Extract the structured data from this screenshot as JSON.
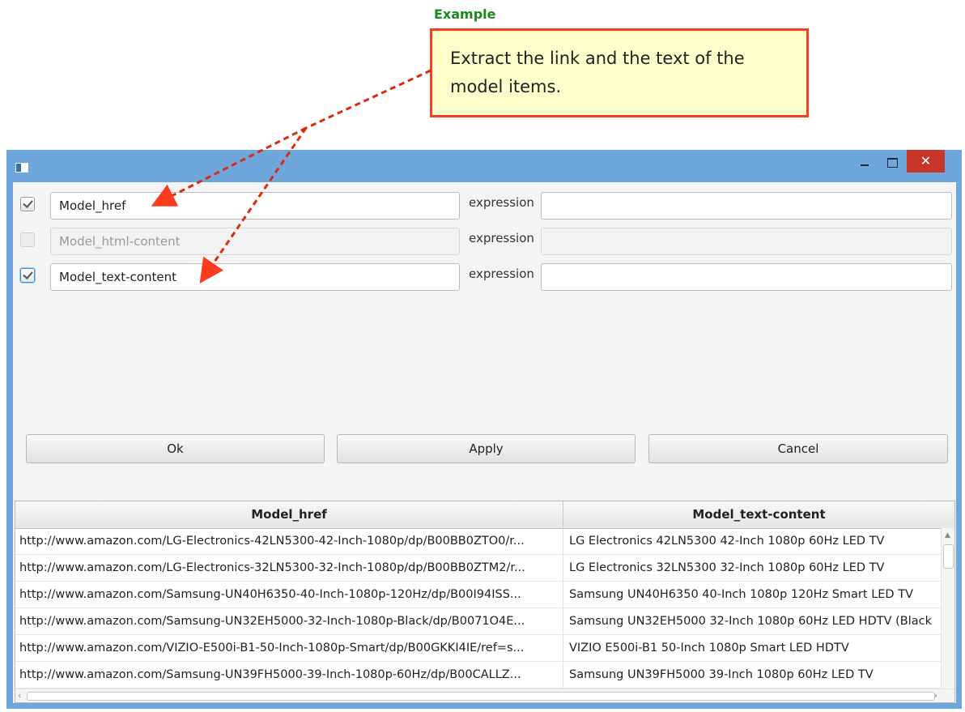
{
  "annotation": {
    "title": "Example",
    "text": "Extract the link and the text of the model items."
  },
  "window": {
    "controls": {
      "minimize": "minimize",
      "maximize": "maximize",
      "close": "✕"
    }
  },
  "fields": [
    {
      "name": "Model_href",
      "checked": true,
      "enabled": true,
      "expression_label": "expression",
      "expression_value": ""
    },
    {
      "name": "Model_html-content",
      "checked": false,
      "enabled": false,
      "expression_label": "expression",
      "expression_value": ""
    },
    {
      "name": "Model_text-content",
      "checked": true,
      "enabled": true,
      "expression_label": "expression",
      "expression_value": ""
    }
  ],
  "buttons": {
    "ok": "Ok",
    "apply": "Apply",
    "cancel": "Cancel"
  },
  "table": {
    "columns": [
      "Model_href",
      "Model_text-content"
    ],
    "rows": [
      [
        "http://www.amazon.com/LG-Electronics-42LN5300-42-Inch-1080p/dp/B00BB0ZTO0/r...",
        "LG Electronics 42LN5300 42-Inch 1080p 60Hz LED TV"
      ],
      [
        "http://www.amazon.com/LG-Electronics-32LN5300-32-Inch-1080p/dp/B00BB0ZTM2/r...",
        "LG Electronics 32LN5300 32-Inch 1080p 60Hz LED TV"
      ],
      [
        "http://www.amazon.com/Samsung-UN40H6350-40-Inch-1080p-120Hz/dp/B00I94ISS...",
        "Samsung UN40H6350 40-Inch 1080p 120Hz Smart LED TV"
      ],
      [
        "http://www.amazon.com/Samsung-UN32EH5000-32-Inch-1080p-Black/dp/B0071O4E...",
        "Samsung UN32EH5000 32-Inch 1080p 60Hz LED HDTV (Black"
      ],
      [
        "http://www.amazon.com/VIZIO-E500i-B1-50-Inch-1080p-Smart/dp/B00GKKI4IE/ref=s...",
        "VIZIO E500i-B1 50-Inch 1080p Smart LED HDTV"
      ],
      [
        "http://www.amazon.com/Samsung-UN39FH5000-39-Inch-1080p-60Hz/dp/B00CALLZ...",
        "Samsung UN39FH5000 39-Inch 1080p 60Hz LED TV"
      ]
    ]
  }
}
